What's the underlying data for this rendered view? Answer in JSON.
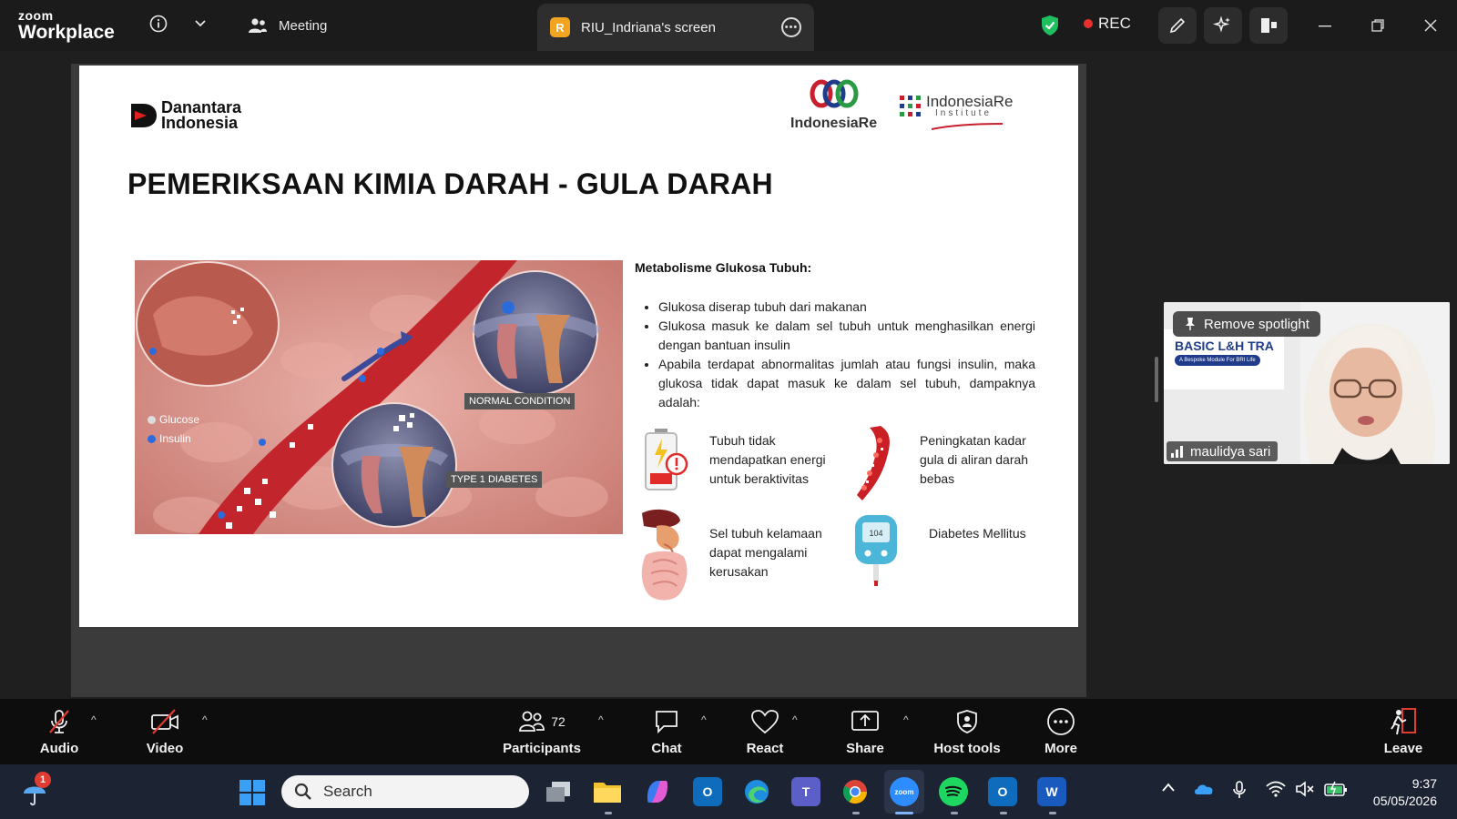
{
  "app": {
    "brand_small": "zoom",
    "brand_large": "Workplace"
  },
  "titlebar": {
    "meeting_label": "Meeting",
    "screen_badge": "R",
    "screen_tab_label": "RIU_Indriana's screen",
    "rec_label": "REC"
  },
  "slide": {
    "logo_danantara_line1": "Danantara",
    "logo_danantara_line2": "Indonesia",
    "logo_indonesiare": "IndonesiaRe",
    "logo_institute_line1": "IndonesiaRe",
    "logo_institute_line2": "Institute",
    "title": "PEMERIKSAAN KIMIA DARAH - GULA DARAH",
    "illustration": {
      "tag_normal": "NORMAL CONDITION",
      "tag_type1": "TYPE 1 DIABETES",
      "legend_glucose": "Glucose",
      "legend_insulin": "Insulin"
    },
    "section_title": "Metabolisme Glukosa Tubuh:",
    "bullets": [
      "Glukosa diserap tubuh dari makanan",
      "Glukosa masuk ke dalam sel tubuh untuk menghasilkan energi dengan bantuan insulin",
      "Apabila terdapat abnormalitas jumlah atau fungsi insulin, maka glukosa tidak dapat masuk ke dalam sel tubuh, dampaknya adalah:"
    ],
    "effects": [
      {
        "text": "Tubuh tidak mendapatkan energi untuk beraktivitas",
        "icon": "low-battery-icon"
      },
      {
        "text": "Peningkatan kadar gula di aliran darah bebas",
        "icon": "blood-vessel-icon"
      },
      {
        "text": "Sel tubuh kelamaan dapat mengalami kerusakan",
        "icon": "organs-icon"
      },
      {
        "text": "Diabetes Mellitus",
        "icon": "glucometer-icon"
      }
    ],
    "glucometer_reading": "104"
  },
  "participant": {
    "spotlight_label": "Remove spotlight",
    "name": "maulidya sari",
    "banner_title": "BASIC L&H TRA",
    "banner_sub": "A Bespoke Module For BRI Life"
  },
  "toolbar": {
    "audio": "Audio",
    "video": "Video",
    "participants": "Participants",
    "participants_count": "72",
    "chat": "Chat",
    "react": "React",
    "share": "Share",
    "host_tools": "Host tools",
    "more": "More",
    "leave": "Leave"
  },
  "taskbar": {
    "search_placeholder": "Search",
    "notification_count": "1",
    "time": "9:37",
    "date": "05/05/2026",
    "zoom_app_label": "zoom"
  },
  "colors": {
    "rec_dot": "#e8312f",
    "shield": "#1fbf5f",
    "screen_badge": "#f2a31f",
    "leave": "#e03c31"
  }
}
